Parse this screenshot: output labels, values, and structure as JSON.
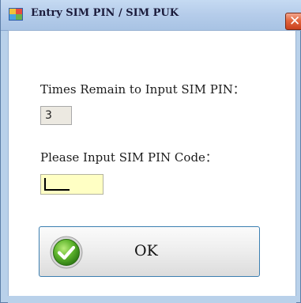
{
  "window": {
    "title": "Entry SIM PIN / SIM PUK",
    "close_glyph": "✕",
    "accent_color": "#e2663f"
  },
  "form": {
    "remain_label": "Times Remain to Input SIM PIN：",
    "remain_value": "3",
    "pin_label": "Please Input SIM PIN Code：",
    "pin_value": ""
  },
  "ok_button": {
    "label": "OK",
    "icon": "checkmark-icon"
  }
}
